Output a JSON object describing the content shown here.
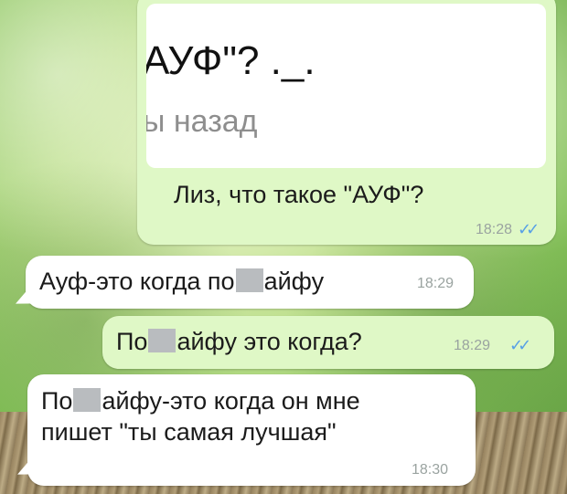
{
  "colors": {
    "outgoing_bubble": "#dff8c6",
    "incoming_bubble": "#ffffff",
    "read_ticks": "#57a0e6",
    "timestamp": "#9aa3a0"
  },
  "quoted_image": {
    "title_line": "АУФ\"? ._.",
    "subtitle_line": "ы назад"
  },
  "messages": [
    {
      "direction": "outgoing",
      "text": "Лиз, что такое \"АУФ\"?",
      "time": "18:28",
      "status_icon": "double-check-icon",
      "ticks": "✓✓"
    },
    {
      "direction": "incoming",
      "text_before": "Ауф-это когда по",
      "text_after": "айфу",
      "time": "18:29"
    },
    {
      "direction": "outgoing",
      "text_before": "По",
      "text_after": "айфу это когда?",
      "time": "18:29",
      "status_icon": "double-check-icon",
      "ticks": "✓✓"
    },
    {
      "direction": "incoming",
      "text_before": "По",
      "text_after": "айфу-это когда он мне",
      "text_line2": "пишет \"ты самая лучшая\"",
      "time": "18:30"
    }
  ]
}
